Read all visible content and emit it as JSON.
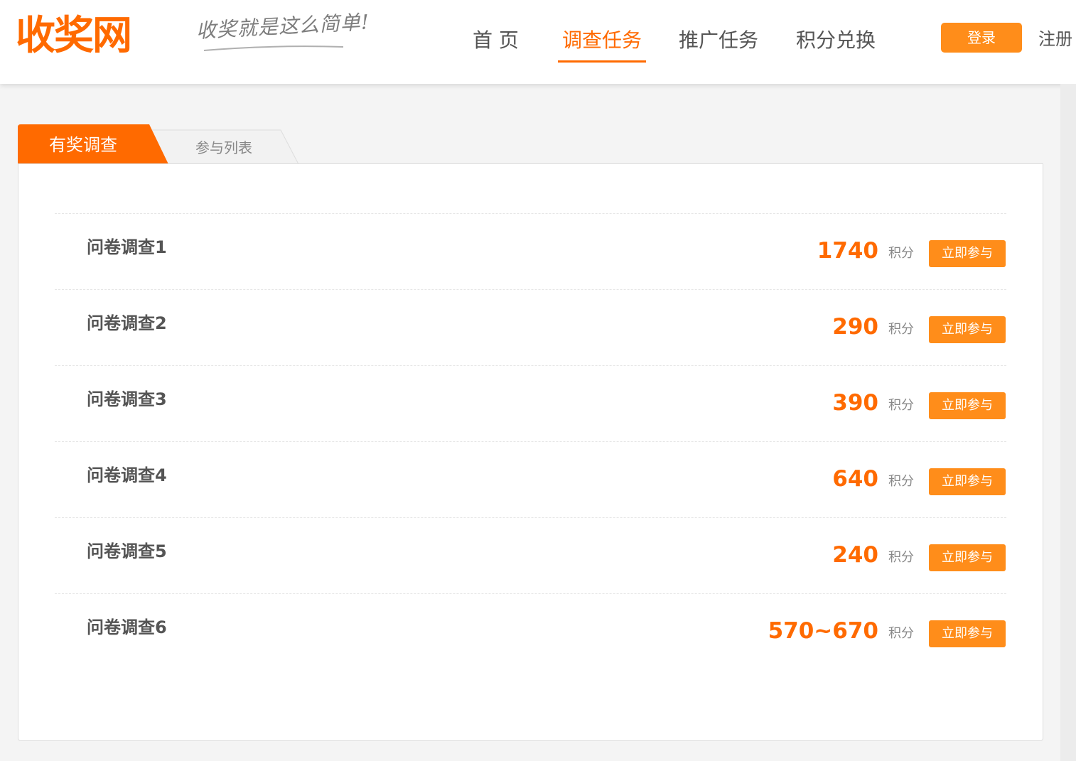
{
  "header": {
    "logo": "收奖网",
    "slogan": "收奖就是这么简单!",
    "nav": [
      {
        "label": "首  页",
        "active": false
      },
      {
        "label": "调查任务",
        "active": true
      },
      {
        "label": "推广任务",
        "active": false
      },
      {
        "label": "积分兑换",
        "active": false
      }
    ],
    "login_label": "登录",
    "register_label": "注册"
  },
  "tabs": [
    {
      "label": "有奖调查",
      "active": true
    },
    {
      "label": "参与列表",
      "active": false
    }
  ],
  "survey_list": [
    {
      "title": "问卷调查1",
      "points": "1740",
      "unit": "积分",
      "action": "立即参与"
    },
    {
      "title": "问卷调查2",
      "points": "290",
      "unit": "积分",
      "action": "立即参与"
    },
    {
      "title": "问卷调查3",
      "points": "390",
      "unit": "积分",
      "action": "立即参与"
    },
    {
      "title": "问卷调查4",
      "points": "640",
      "unit": "积分",
      "action": "立即参与"
    },
    {
      "title": "问卷调查5",
      "points": "240",
      "unit": "积分",
      "action": "立即参与"
    },
    {
      "title": "问卷调查6",
      "points": "570~670",
      "unit": "积分",
      "action": "立即参与"
    }
  ],
  "colors": {
    "brand_orange": "#ff6a00",
    "button_orange": "#ff8d1a"
  }
}
